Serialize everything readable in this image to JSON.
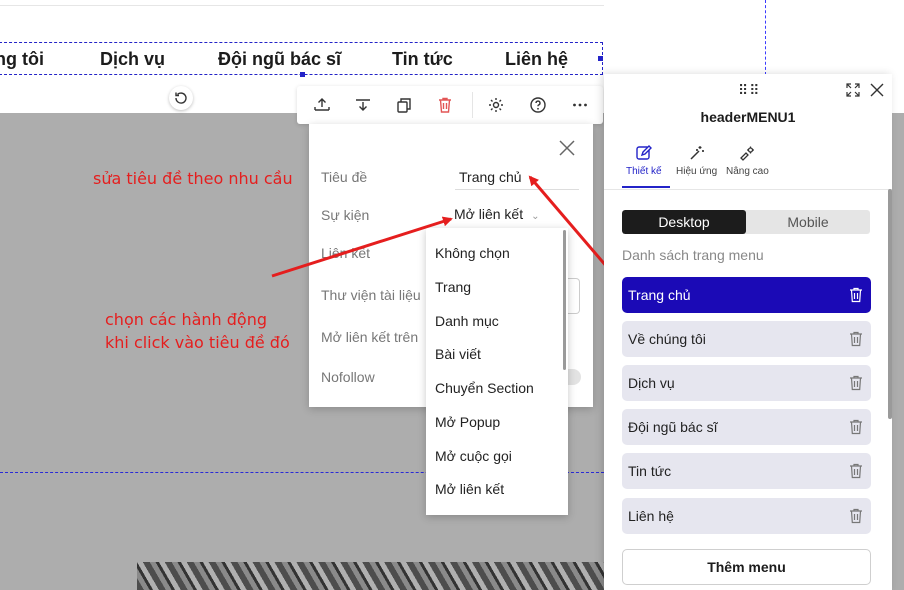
{
  "nav_menu": {
    "items": [
      "ng tôi",
      "Dịch vụ",
      "Đội ngũ bác sĩ",
      "Tin tức",
      "Liên hệ"
    ]
  },
  "toolbar": {
    "icons": [
      "move-up-icon",
      "move-down-icon",
      "duplicate-icon",
      "delete-icon",
      "settings-icon",
      "help-icon",
      "more-icon"
    ]
  },
  "link_popup": {
    "fields": {
      "title_label": "Tiêu đề",
      "title_value": "Trang chủ",
      "event_label": "Sự kiện",
      "event_value": "Mở liên kết",
      "link_label": "Liên kết",
      "library_label": "Thư viện tài liệu",
      "open_in_label": "Mở liên kết trên",
      "nofollow_label": "Nofollow"
    }
  },
  "event_dropdown": {
    "options": [
      "Không chọn",
      "Trang",
      "Danh mục",
      "Bài viết",
      "Chuyển Section",
      "Mở Popup",
      "Mở cuộc gọi",
      "Mở liên kết"
    ]
  },
  "annotations": {
    "edit_title": "sửa tiêu đề theo nhu cầu",
    "choose_action_line1": "chọn các hành động",
    "choose_action_line2": "khi click vào tiêu đề đó"
  },
  "right_panel": {
    "title": "headerMENU1",
    "tabs": [
      {
        "label": "Thiết kế",
        "icon": "edit-icon",
        "active": true
      },
      {
        "label": "Hiệu ứng",
        "icon": "magic-wand-icon",
        "active": false
      },
      {
        "label": "Nâng cao",
        "icon": "advanced-settings-icon",
        "active": false
      }
    ],
    "device_toggle": {
      "desktop": "Desktop",
      "mobile": "Mobile",
      "selected": "Desktop"
    },
    "section_label": "Danh sách trang menu",
    "menu_items": [
      {
        "label": "Trang chủ",
        "selected": true
      },
      {
        "label": "Về chúng tôi",
        "selected": false
      },
      {
        "label": "Dịch vụ",
        "selected": false
      },
      {
        "label": "Đội ngũ bác sĩ",
        "selected": false
      },
      {
        "label": "Tin tức",
        "selected": false
      },
      {
        "label": "Liên hệ",
        "selected": false
      }
    ],
    "add_button": "Thêm menu"
  },
  "colors": {
    "accent": "#1b0ab6",
    "annotation": "#e51e1e",
    "delete": "#e25555"
  }
}
